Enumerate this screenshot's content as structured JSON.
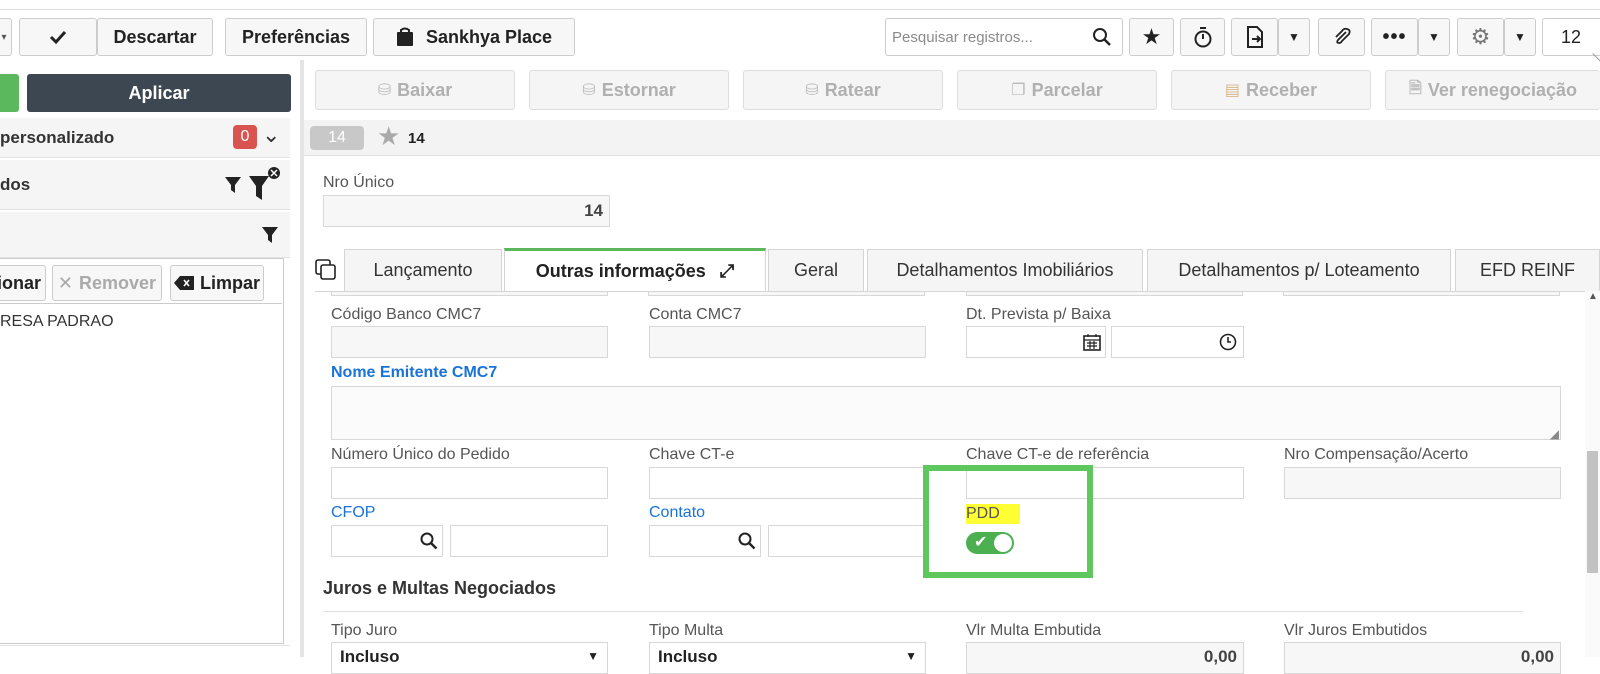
{
  "toolbar": {
    "descartar": "Descartar",
    "preferencias": "Preferências",
    "sankhya_place": "Sankhya Place",
    "search_placeholder": "Pesquisar registros...",
    "page_number": "12"
  },
  "actions": {
    "baixar": "Baixar",
    "estornar": "Estornar",
    "ratear": "Ratear",
    "parcelar": "Parcelar",
    "receber": "Receber",
    "ver_renegociacao": "Ver renegociação"
  },
  "left": {
    "aplicar": "Aplicar",
    "filter_personalizado": "personalizado",
    "filter_count": "0",
    "filter_dos": "dos",
    "btn_adicionar": "ionar",
    "btn_remover": "Remover",
    "btn_limpar": "Limpar",
    "list_item": "RESA PADRAO"
  },
  "record": {
    "badge": "14",
    "fav_number": "14",
    "nro_unico_label": "Nro Único",
    "nro_unico_value": "14"
  },
  "tabs": [
    {
      "label": "Lançamento"
    },
    {
      "label": "Outras informações"
    },
    {
      "label": "Geral"
    },
    {
      "label": "Detalhamentos Imobiliários"
    },
    {
      "label": "Detalhamentos p/ Loteamento"
    },
    {
      "label": "EFD REINF"
    }
  ],
  "form": {
    "codigo_banco": "Código Banco CMC7",
    "conta_cmc7": "Conta CMC7",
    "dt_prevista": "Dt. Prevista p/ Baixa",
    "nome_emitente": "Nome Emitente CMC7",
    "numero_pedido": "Número Único do Pedido",
    "chave_cte": "Chave CT-e",
    "chave_cte_ref": "Chave CT-e de referência",
    "nro_compensacao": "Nro Compensação/Acerto",
    "cfop": "CFOP",
    "contato": "Contato",
    "pdd": "PDD",
    "pdd_on": true,
    "section_juros": "Juros e Multas Negociados",
    "tipo_juro": "Tipo Juro",
    "tipo_juro_value": "Incluso",
    "tipo_multa": "Tipo Multa",
    "tipo_multa_value": "Incluso",
    "vlr_multa": "Vlr Multa Embutida",
    "vlr_multa_value": "0,00",
    "vlr_juros": "Vlr Juros Embutidos",
    "vlr_juros_value": "0,00"
  },
  "colors": {
    "accent_green": "#5cb85c",
    "highlight_yellow": "#ffff33",
    "link_blue": "#1a73d9",
    "badge_red": "#d9534f",
    "aplicar_bg": "#3d4752"
  }
}
